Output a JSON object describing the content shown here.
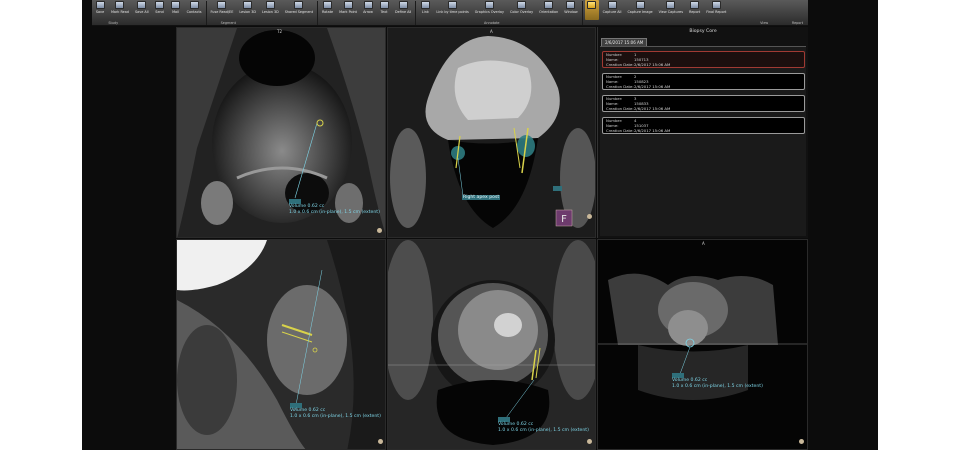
{
  "toolbar": {
    "buttons": [
      {
        "label": "Save",
        "active": false
      },
      {
        "label": "Mark Read",
        "active": false
      },
      {
        "label": "Save All",
        "active": false
      },
      {
        "label": "Send",
        "active": false
      },
      {
        "label": "Mail",
        "active": false
      },
      {
        "label": "Contacts",
        "active": false
      },
      {
        "label": "Fuse Read/EE",
        "active": false
      },
      {
        "label": "Lesion 3D",
        "active": false
      },
      {
        "label": "Lesion 3D",
        "active": false
      },
      {
        "label": "Shared Segment",
        "active": false
      },
      {
        "label": "Rotate",
        "active": false
      },
      {
        "label": "Mark Point",
        "active": false
      },
      {
        "label": "Arrow",
        "active": false
      },
      {
        "label": "Text",
        "active": false
      },
      {
        "label": "Define All",
        "active": false
      },
      {
        "label": "Link",
        "active": false
      },
      {
        "label": "Link by time points",
        "active": false
      },
      {
        "label": "Graphics Overlay",
        "active": false
      },
      {
        "label": "Color Overlay",
        "active": false
      },
      {
        "label": "Orientation",
        "active": false
      },
      {
        "label": "Window",
        "active": false
      },
      {
        "label": "",
        "active": true
      },
      {
        "label": "Capture All",
        "active": false
      },
      {
        "label": "Capture Image",
        "active": false
      },
      {
        "label": "View Captures",
        "active": false
      },
      {
        "label": "Report",
        "active": false
      },
      {
        "label": "Final Report",
        "active": false
      }
    ],
    "groups": [
      "Study",
      "Segment",
      "Annotate",
      "View",
      "Report"
    ]
  },
  "viewports": {
    "top_left": {
      "tag": "T2",
      "label": "Volume 0.62 cc",
      "size": "1.0 x 0.6 cm (in-plane), 1.5 cm (extent)"
    },
    "top_middle": {
      "tag": "A",
      "label": "Right apex post"
    },
    "bottom_left": {
      "label": "Volume 0.62 cc",
      "size": "1.0 x 0.6 cm (in-plane), 1.5 cm (extent)"
    },
    "bottom_middle": {
      "label": "Volume 0.62 cc",
      "size": "1.0 x 0.6 cm (in-plane), 1.5 cm (extent)"
    },
    "bottom_right": {
      "tag": "A",
      "label": "Volume 0.62 cc",
      "size": "1.0 x 0.6 cm (in-plane), 1.5 cm (extent)"
    }
  },
  "panel": {
    "title": "Biopsy Core",
    "tab": "2/6/2017 15:06 AM",
    "keys": {
      "number": "Number:",
      "name": "Name:",
      "date": "Creation Date:"
    },
    "cores": [
      {
        "number": "1",
        "name": "150713",
        "date": "2/6/2017 15:06 AM",
        "selected": true
      },
      {
        "number": "2",
        "name": "150823",
        "date": "2/6/2017 15:06 AM",
        "selected": false
      },
      {
        "number": "3",
        "name": "150833",
        "date": "2/6/2017 15:06 AM",
        "selected": false
      },
      {
        "number": "4",
        "name": "151037",
        "date": "2/6/2017 15:06 AM",
        "selected": false
      }
    ]
  },
  "colors": {
    "annotation": "#7fd6e8",
    "needle": "#d8d24a",
    "selected_border": "#a03a33"
  }
}
